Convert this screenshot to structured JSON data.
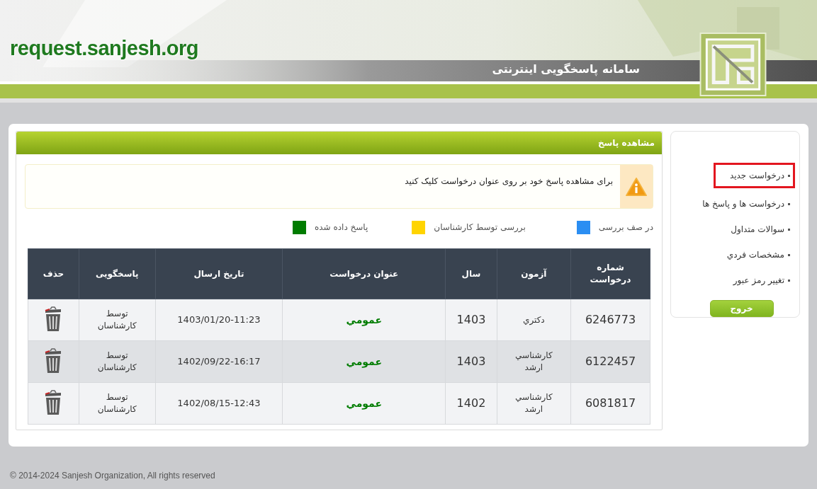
{
  "header": {
    "site_address": "request.sanjesh.org",
    "title": "سامانه پاسخگویی اینترنتی"
  },
  "sidebar": {
    "items": [
      {
        "label": "درخواست جدید",
        "highlighted": true
      },
      {
        "label": "درخواست ها و پاسخ ها",
        "highlighted": false
      },
      {
        "label": "سوالات متداول",
        "highlighted": false
      },
      {
        "label": "مشخصات فردي",
        "highlighted": false
      },
      {
        "label": "تغيير رمز عبور",
        "highlighted": false
      }
    ],
    "logout_button": "خروج"
  },
  "panel": {
    "title": "مشاهده پاسخ",
    "notice": "برای مشاهده پاسخ خود بر روی عنوان درخواست کلیک کنید",
    "legend": [
      {
        "label": "در صف بررسی",
        "color": "#2b8ef2"
      },
      {
        "label": "بررسی توسط کارشناسان",
        "color": "#ffd400"
      },
      {
        "label": "پاسخ داده شده",
        "color": "#007c00"
      }
    ],
    "table": {
      "columns": [
        "شماره درخواست",
        "آزمون",
        "سال",
        "عنوان درخواست",
        "تاریخ ارسال",
        "پاسخگویی",
        "حذف"
      ],
      "rows": [
        {
          "number": "6246773",
          "exam": "دكتري",
          "year": "1403",
          "title": "عمومي",
          "color": "#007c00",
          "sent": "1403/01/20-11:23",
          "responder": "توسط کارشناسان"
        },
        {
          "number": "6122457",
          "exam": "كارشناسي ارشد",
          "year": "1403",
          "title": "عمومي",
          "color": "#007c00",
          "sent": "1402/09/22-16:17",
          "responder": "توسط کارشناسان"
        },
        {
          "number": "6081817",
          "exam": "كارشناسي ارشد",
          "year": "1402",
          "title": "عمومي",
          "color": "#007c00",
          "sent": "1402/08/15-12:43",
          "responder": "توسط کارشناسان"
        }
      ]
    }
  },
  "footer": "© 2014-2024 Sanjesh Organization, All rights reserved"
}
